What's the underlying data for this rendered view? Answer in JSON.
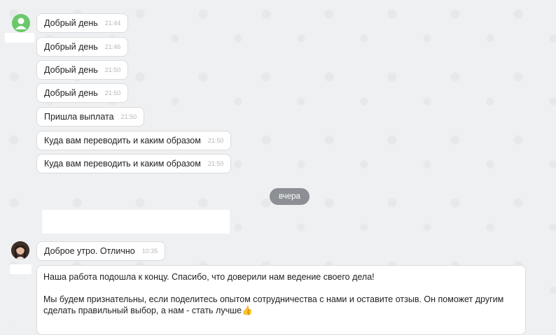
{
  "messages_in": [
    {
      "text": "Добрый день",
      "time": "21:44"
    },
    {
      "text": "Добрый день",
      "time": "21:46"
    },
    {
      "text": "Добрый день",
      "time": "21:50"
    },
    {
      "text": "Добрый день",
      "time": "21:50"
    },
    {
      "text": "Пришла выплата",
      "time": "21:50"
    },
    {
      "text": "Куда вам переводить и каким образом",
      "time": "21:50"
    },
    {
      "text": "Куда вам переводить и каким образом",
      "time": "21:50"
    }
  ],
  "date_separator": "вчера",
  "reply": {
    "text": "Доброе утро. Отлично",
    "time": "10:35"
  },
  "final_message": {
    "paragraph1": "Наша работа подошла к концу. Спасибо, что доверили нам ведение своего дела!",
    "paragraph2": "Мы будем признательны, если поделитесь опытом сотрудничества с нами и оставите отзыв. Он поможет другим сделать правильный выбор, а нам - стать лучше👍"
  },
  "colors": {
    "avatar_green": "#6bc86a",
    "date_chip": "#8c8f93",
    "background": "#eef0f2"
  }
}
